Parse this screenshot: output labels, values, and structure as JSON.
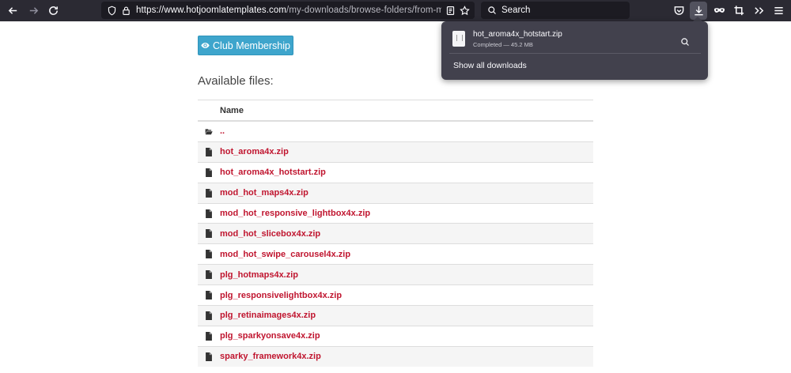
{
  "browser": {
    "url_host": "https://www.hotjoomlatemplates.com",
    "url_path": "/my-downloads/browse-folders/from-membership",
    "search_placeholder": "Search"
  },
  "downloads_panel": {
    "file_name": "hot_aroma4x_hotstart.zip",
    "status": "Completed — 45.2 MB",
    "show_all_label": "Show all downloads"
  },
  "page": {
    "club_button_label": "Club Membership",
    "section_heading": "Available files:",
    "table_header": "Name",
    "files": [
      {
        "name": "..",
        "icon": "folder-open-icon"
      },
      {
        "name": "hot_aroma4x.zip",
        "icon": "file-icon"
      },
      {
        "name": "hot_aroma4x_hotstart.zip",
        "icon": "file-icon"
      },
      {
        "name": "mod_hot_maps4x.zip",
        "icon": "file-icon"
      },
      {
        "name": "mod_hot_responsive_lightbox4x.zip",
        "icon": "file-icon"
      },
      {
        "name": "mod_hot_slicebox4x.zip",
        "icon": "file-icon"
      },
      {
        "name": "mod_hot_swipe_carousel4x.zip",
        "icon": "file-icon"
      },
      {
        "name": "plg_hotmaps4x.zip",
        "icon": "file-icon"
      },
      {
        "name": "plg_responsivelightbox4x.zip",
        "icon": "file-icon"
      },
      {
        "name": "plg_retinaimages4x.zip",
        "icon": "file-icon"
      },
      {
        "name": "plg_sparkyonsave4x.zip",
        "icon": "file-icon"
      },
      {
        "name": "sparky_framework4x.zip",
        "icon": "file-icon"
      }
    ]
  },
  "colors": {
    "toolbar_bg": "#2b2a33",
    "link_red": "#c0152f",
    "button_blue": "#3ea5cc",
    "panel_bg": "#42414d"
  }
}
